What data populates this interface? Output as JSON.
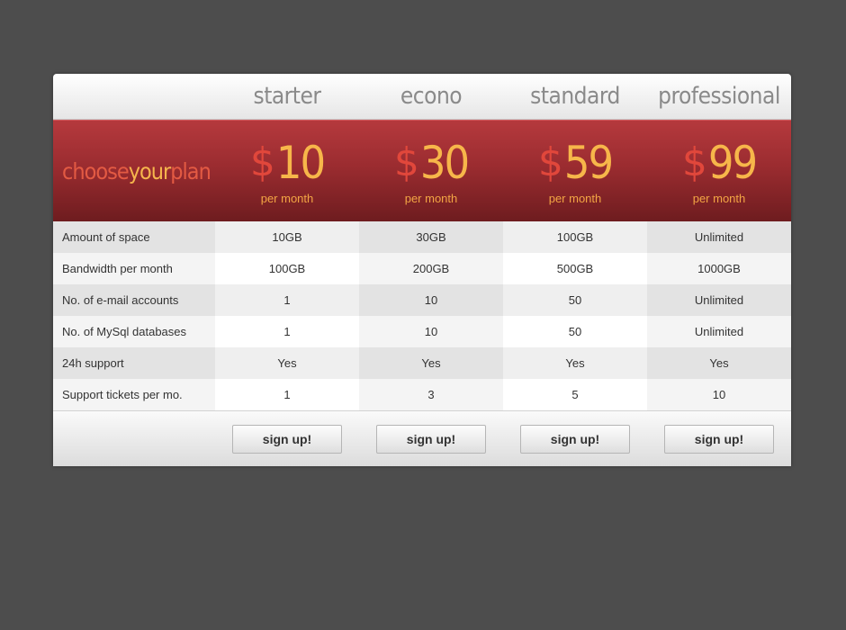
{
  "plans": [
    {
      "name": "starter",
      "currency": "$",
      "amount": "10",
      "period": "per month",
      "signup_label": "sign up!"
    },
    {
      "name": "econo",
      "currency": "$",
      "amount": "30",
      "period": "per month",
      "signup_label": "sign up!"
    },
    {
      "name": "standard",
      "currency": "$",
      "amount": "59",
      "period": "per month",
      "signup_label": "sign up!"
    },
    {
      "name": "professional",
      "currency": "$",
      "amount": "99",
      "period": "per month",
      "signup_label": "sign up!"
    }
  ],
  "tagline": {
    "part1": "choose ",
    "part2": "your",
    "part3": " plan"
  },
  "features": [
    {
      "label": "Amount of space",
      "values": [
        "10GB",
        "30GB",
        "100GB",
        "Unlimited"
      ]
    },
    {
      "label": "Bandwidth per month",
      "values": [
        "100GB",
        "200GB",
        "500GB",
        "1000GB"
      ]
    },
    {
      "label": "No. of e-mail accounts",
      "values": [
        "1",
        "10",
        "50",
        "Unlimited"
      ]
    },
    {
      "label": "No. of MySql databases",
      "values": [
        "1",
        "10",
        "50",
        "Unlimited"
      ]
    },
    {
      "label": "24h support",
      "values": [
        "Yes",
        "Yes",
        "Yes",
        "Yes"
      ]
    },
    {
      "label": "Support tickets per mo.",
      "values": [
        "1",
        "3",
        "5",
        "10"
      ]
    }
  ],
  "colors": {
    "background": "#4d4d4d",
    "banner_red": "#9b2c30",
    "price_orange": "#f7b64a",
    "currency_red": "#e1473b"
  }
}
